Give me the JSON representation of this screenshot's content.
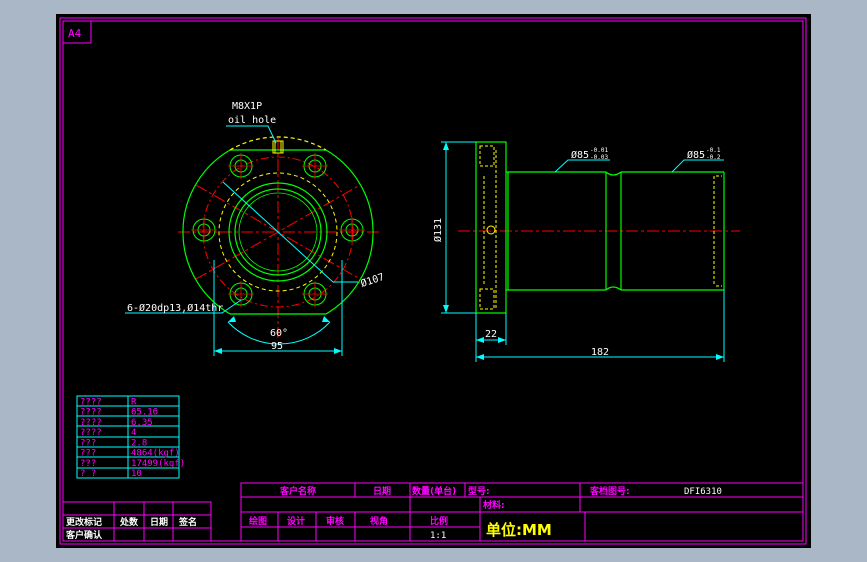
{
  "sheet": {
    "size_label": "A4"
  },
  "front_view": {
    "callout_thread": "M8X1P",
    "callout_oil": "oil hole",
    "bolt_holes_note": "6-Ø20dp13,Ø14thr",
    "pcd_label": "Ø107",
    "angle_label": "60°",
    "width_label": "95"
  },
  "side_view": {
    "dia1_label": "Ø85",
    "dia1_tol_upper": "-0.01",
    "dia1_tol_lower": "-0.03",
    "dia2_label": "Ø85",
    "dia2_tol_upper": "-0.1",
    "dia2_tol_lower": "-0.2",
    "height_label": "Ø131",
    "flange_label": "22",
    "length_label": "182"
  },
  "spec_table": {
    "rows": [
      {
        "key": "????",
        "value": "R"
      },
      {
        "key": "????",
        "value": "65.16"
      },
      {
        "key": "????",
        "value": "6.35"
      },
      {
        "key": "????",
        "value": "4"
      },
      {
        "key": "???",
        "value": "2.8"
      },
      {
        "key": "???",
        "value": "4864(kgf)"
      },
      {
        "key": "???",
        "value": "17499(kgf)"
      },
      {
        "key": "? ?",
        "value": "10"
      }
    ]
  },
  "revision_block": {
    "cells": [
      "更改标记",
      "处数",
      "日期",
      "签名"
    ],
    "footer": "客户确认"
  },
  "title_block": {
    "customer_name_label": "客户名称",
    "date_label": "日期",
    "quantity_label": "数量(单台)",
    "model_label": "型号:",
    "drawing_no_label": "客档图号:",
    "drawing_no_value": "DFI6310",
    "material_label": "材料:",
    "drawn_label": "绘图",
    "design_label": "设计",
    "review_label": "审核",
    "view_label": "视角",
    "scale_label": "比例",
    "scale_value": "1:1",
    "unit_label": "单位:MM"
  },
  "colors": {
    "background": "#000000",
    "frame": "#ff00ff",
    "outline": "#00ff00",
    "hidden": "#ffff00",
    "center": "#ff0000",
    "dimension": "#00ffff",
    "text": "#ffffff",
    "table_text": "#ff00ff"
  }
}
